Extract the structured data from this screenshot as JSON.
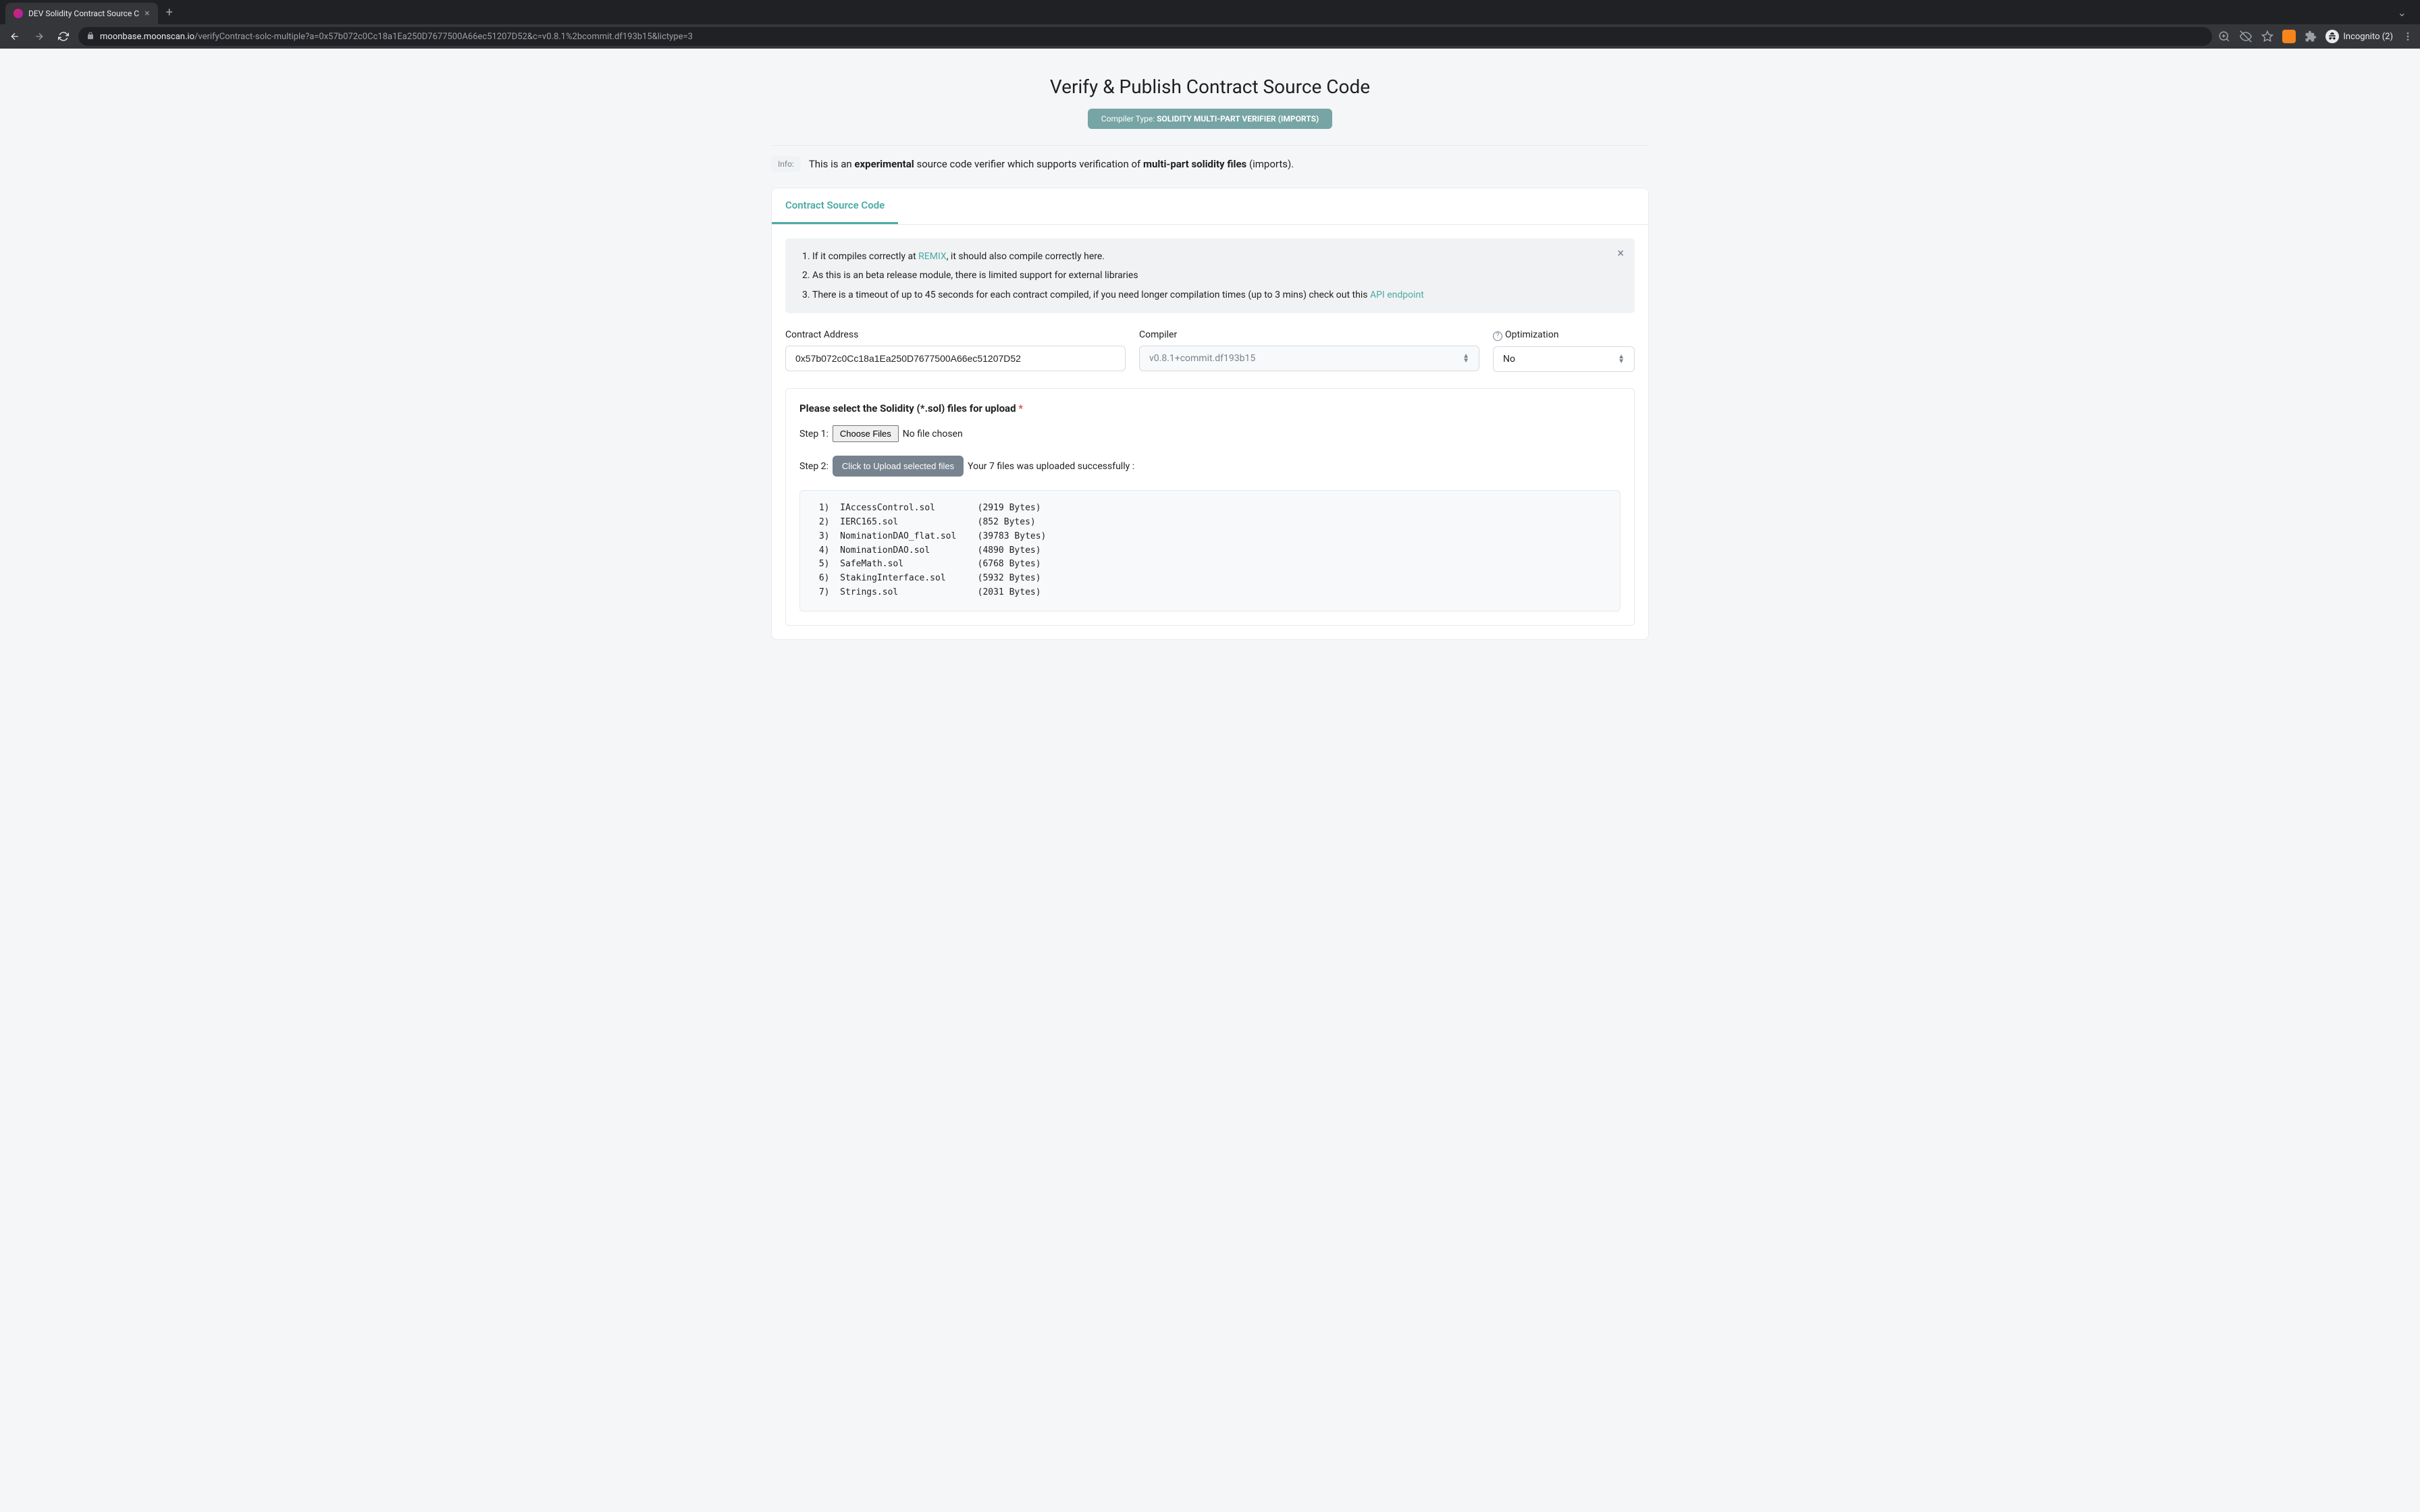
{
  "browser": {
    "tab_title": "DEV Solidity Contract Source C",
    "url_domain": "moonbase.moonscan.io",
    "url_path": "/verifyContract-solc-multiple?a=0x57b072c0Cc18a1Ea250D7677500A66ec51207D52&c=v0.8.1%2bcommit.df193b15&lictype=3",
    "incognito_label": "Incognito (2)"
  },
  "page": {
    "title": "Verify & Publish Contract Source Code",
    "compiler_prefix": "Compiler Type: ",
    "compiler_type": "SOLIDITY MULTI-PART VERIFIER (IMPORTS)",
    "info_label": "Info:",
    "info_text_1": "This is an ",
    "info_text_bold_1": "experimental",
    "info_text_2": " source code verifier which supports verification of ",
    "info_text_bold_2": "multi-part solidity files",
    "info_text_3": " (imports).",
    "tab_label": "Contract Source Code"
  },
  "alert": {
    "item1_a": "If it compiles correctly at ",
    "item1_link": "REMIX",
    "item1_b": ", it should also compile correctly here.",
    "item2": "As this is an beta release module, there is limited support for external libraries",
    "item3_a": "There is a timeout of up to 45 seconds for each contract compiled, if you need longer compilation times (up to 3 mins) check out this ",
    "item3_link": "API endpoint"
  },
  "form": {
    "contract_address_label": "Contract Address",
    "contract_address_value": "0x57b072c0Cc18a1Ea250D7677500A66ec51207D52",
    "compiler_label": "Compiler",
    "compiler_value": "v0.8.1+commit.df193b15",
    "optimization_label": "Optimization",
    "optimization_value": "No"
  },
  "upload": {
    "title": "Please select the Solidity (*.sol) files for upload ",
    "step1_label": "Step 1:",
    "choose_files_btn": "Choose Files",
    "no_file_chosen": "No file chosen",
    "step2_label": "Step 2:",
    "upload_btn": "Click to Upload selected files",
    "upload_status": "Your 7 files was uploaded successfully :",
    "files": [
      {
        "idx": "1)",
        "name": "IAccessControl.sol",
        "size": "(2919 Bytes)"
      },
      {
        "idx": "2)",
        "name": "IERC165.sol",
        "size": "(852 Bytes)"
      },
      {
        "idx": "3)",
        "name": "NominationDAO_flat.sol",
        "size": "(39783 Bytes)"
      },
      {
        "idx": "4)",
        "name": "NominationDAO.sol",
        "size": "(4890 Bytes)"
      },
      {
        "idx": "5)",
        "name": "SafeMath.sol",
        "size": "(6768 Bytes)"
      },
      {
        "idx": "6)",
        "name": "StakingInterface.sol",
        "size": "(5932 Bytes)"
      },
      {
        "idx": "7)",
        "name": "Strings.sol",
        "size": "(2031 Bytes)"
      }
    ]
  }
}
